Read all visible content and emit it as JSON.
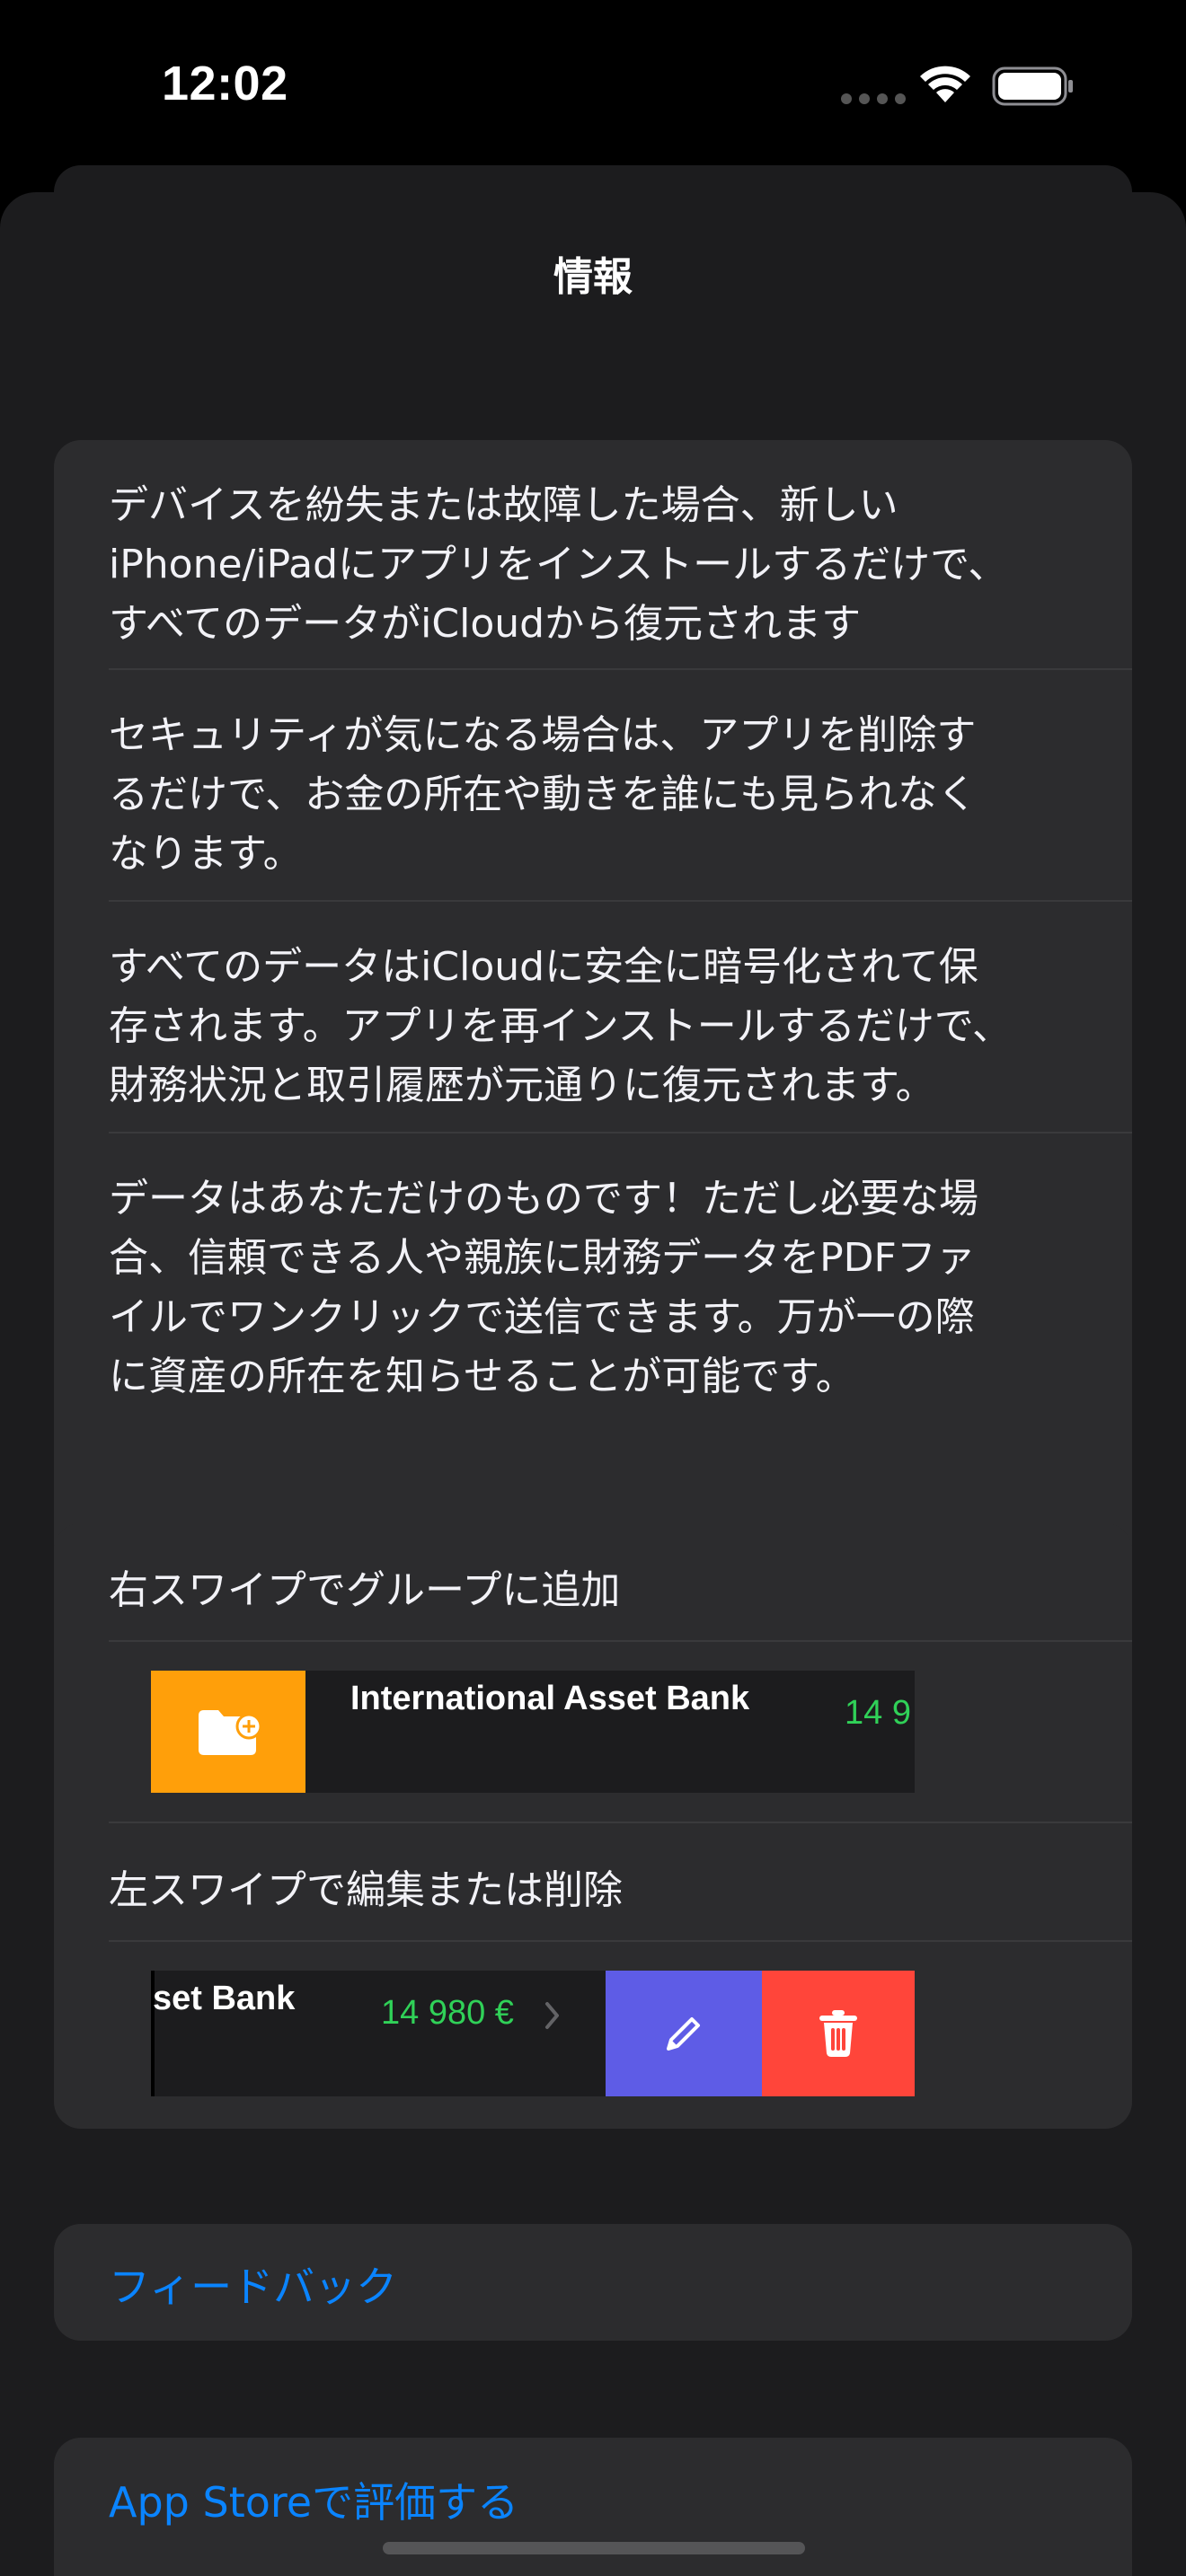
{
  "status_bar": {
    "time": "12:02"
  },
  "sheet": {
    "title": "情報"
  },
  "info": {
    "items": [
      {
        "lines": [
          "デバイスを紛失または故障した場合、新しい",
          "iPhone/iPadにアプリをインストールするだけで、",
          "すべてのデータがiCloudから復元されます"
        ]
      },
      {
        "lines": [
          "セキュリティが気になる場合は、アプリを削除す",
          "るだけで、お金の所在や動きを誰にも見られなく",
          "なります。"
        ]
      },
      {
        "lines": [
          "すべてのデータはiCloudに安全に暗号化されて保",
          "存されます。アプリを再インストールするだけで、",
          "財務状況と取引履歴が元通りに復元されます。"
        ]
      },
      {
        "lines": [
          "データはあなただけのものです！ただし必要な場",
          "合、信頼できる人や親族に財務データをPDFファ",
          "イルでワンクリックで送信できます。万が一の際",
          "に資産の所在を知らせることが可能です。"
        ]
      }
    ]
  },
  "swipe": {
    "right_label": "右スワイプでグループに追加",
    "right_demo": {
      "bank_name": "International Asset Bank",
      "amount_partial": "14 9"
    },
    "left_label": "左スワイプで編集または削除",
    "left_demo": {
      "bank_name_partial": "set Bank",
      "amount": "14 980 €"
    }
  },
  "links": {
    "feedback": "フィードバック",
    "rate": "App Storeで評価する"
  },
  "colors": {
    "background": "#000000",
    "sheet": "#1c1c1e",
    "card": "#2c2c2e",
    "link": "#0a84ff",
    "amount": "#30d158",
    "folder_action": "#ff9f0a",
    "edit_action": "#5e5ce6",
    "delete_action": "#ff453a"
  },
  "icons": {
    "wifi": "wifi-icon",
    "battery": "battery-icon",
    "folder_add": "folder-add-icon",
    "pencil": "pencil-icon",
    "trash": "trash-icon",
    "chevron": "chevron-right-icon"
  }
}
